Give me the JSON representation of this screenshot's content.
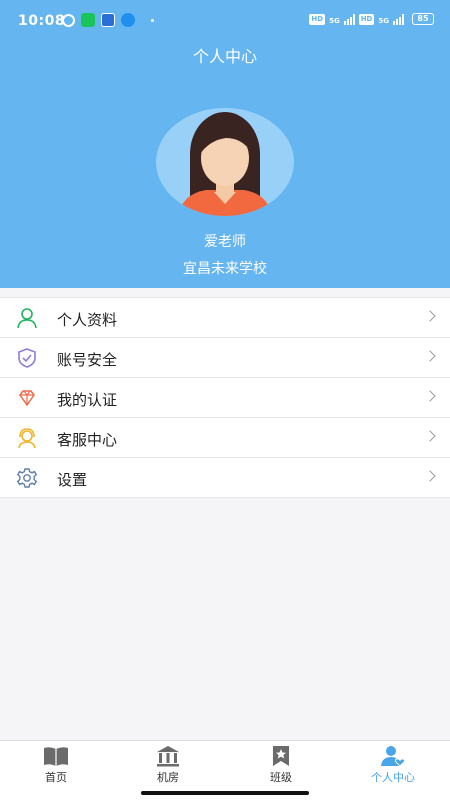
{
  "status_bar": {
    "time": "10:08",
    "network_label": "5G",
    "hd_label": "HD",
    "battery": "85"
  },
  "header": {
    "title": "个人中心",
    "user_name": "爱老师",
    "school": "宜昌未来学校"
  },
  "menu": {
    "items": [
      {
        "label": "个人资料",
        "icon": "user-icon",
        "color": "#1fb35b"
      },
      {
        "label": "账号安全",
        "icon": "shield-icon",
        "color": "#8a7fd6"
      },
      {
        "label": "我的认证",
        "icon": "diamond-icon",
        "color": "#ef6b4b"
      },
      {
        "label": "客服中心",
        "icon": "headset-icon",
        "color": "#f0b429"
      },
      {
        "label": "设置",
        "icon": "gear-icon",
        "color": "#5e7fa8"
      }
    ]
  },
  "tabbar": {
    "tabs": [
      {
        "label": "首页",
        "icon": "book-icon"
      },
      {
        "label": "机房",
        "icon": "bank-icon"
      },
      {
        "label": "班级",
        "icon": "bookmark-star-icon"
      },
      {
        "label": "个人中心",
        "icon": "user-heart-icon",
        "active": true
      }
    ],
    "active_color": "#4aa4e8",
    "inactive_color": "#6b6b6b"
  },
  "colors": {
    "header_bg": "#65b5f1",
    "avatar_bg": "#98d0f8"
  }
}
